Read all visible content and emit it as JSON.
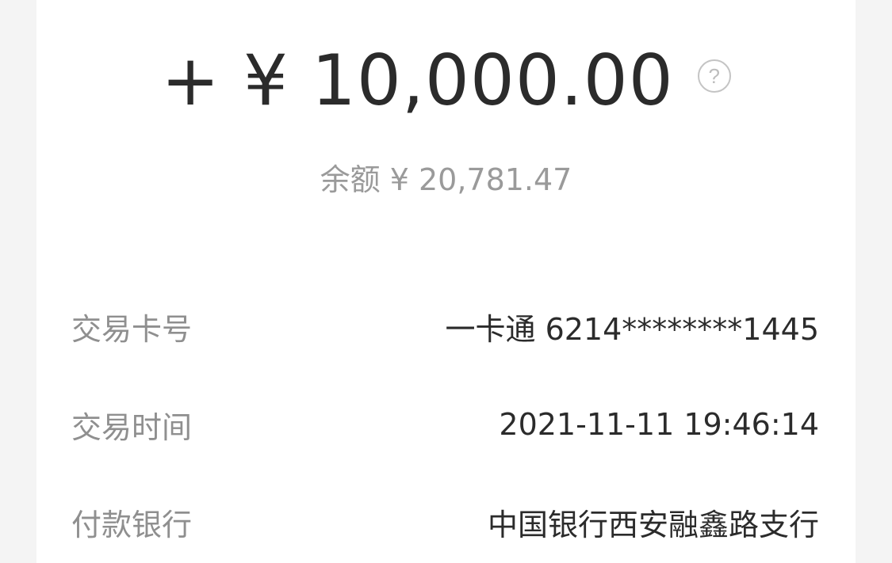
{
  "transaction": {
    "amount": "+ ¥ 10,000.00",
    "balance": "余额 ¥ 20,781.47"
  },
  "details": [
    {
      "label": "交易卡号",
      "value": "一卡通 6214********1445"
    },
    {
      "label": "交易时间",
      "value": "2021-11-11 19:46:14"
    },
    {
      "label": "付款银行",
      "value": "中国银行西安融鑫路支行"
    }
  ],
  "icons": {
    "help": "question-mark-circle"
  }
}
